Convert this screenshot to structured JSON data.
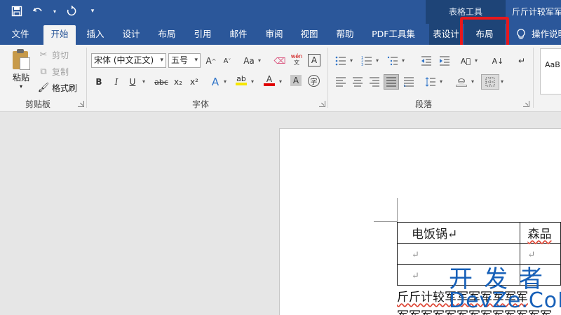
{
  "title_bar": {
    "context_group_label": "表格工具",
    "document_title": "斤斤计较军军军"
  },
  "tabs": [
    {
      "label": "文件"
    },
    {
      "label": "开始"
    },
    {
      "label": "插入"
    },
    {
      "label": "设计"
    },
    {
      "label": "布局"
    },
    {
      "label": "引用"
    },
    {
      "label": "邮件"
    },
    {
      "label": "审阅"
    },
    {
      "label": "视图"
    },
    {
      "label": "帮助"
    },
    {
      "label": "PDF工具集"
    },
    {
      "label": "表设计"
    },
    {
      "label": "布局"
    },
    {
      "label": "操作说明"
    }
  ],
  "active_tab_index": 1,
  "highlighted_tab_index": 12,
  "clipboard": {
    "paste_label": "粘贴",
    "cut_label": "剪切",
    "copy_label": "复制",
    "format_painter_label": "格式刷",
    "group_label": "剪贴板"
  },
  "font": {
    "font_name": "宋体 (中文正文)",
    "font_size": "五号",
    "group_label": "字体",
    "wen_glyph": "wén",
    "bold": "B",
    "italic": "I",
    "underline": "U",
    "strike": "abc",
    "sub": "x₂",
    "sup": "x²",
    "grow": "A",
    "shrink": "A",
    "case": "Aa",
    "effects": "A",
    "highlight": "ab",
    "font_color": "A",
    "char_shading": "A",
    "enclose": "字",
    "border": "A"
  },
  "paragraph": {
    "group_label": "段落"
  },
  "styles": {
    "preview": "AaB"
  },
  "document": {
    "table_rows": [
      [
        "电饭锅↵",
        "森品"
      ],
      [
        "↵",
        "↵"
      ],
      [
        "↵",
        "↵"
      ]
    ],
    "body_line_1": "斤斤计较军军军军军军军",
    "body_line_2": "军军军军军军军军军军军军军"
  },
  "watermark": {
    "line1": "开发者",
    "line2": "DevZe.CoM"
  },
  "colors": {
    "ribbon_blue": "#2b579a",
    "highlight_red": "#e8181c",
    "watermark_blue": "#1760b8"
  }
}
